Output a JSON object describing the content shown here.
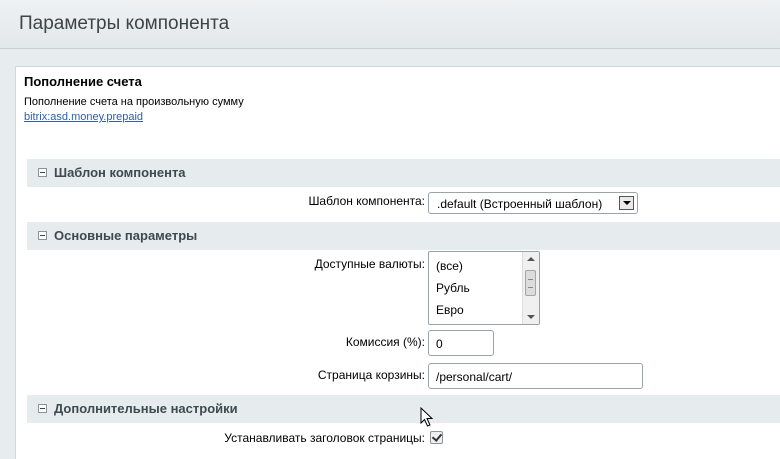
{
  "window": {
    "title": "Параметры компонента"
  },
  "component": {
    "name": "Пополнение счета",
    "description": "Пополнение счета на произвольную сумму",
    "id": "bitrix:asd.money.prepaid"
  },
  "sections": [
    {
      "title": "Шаблон компонента",
      "fields": [
        {
          "label": "Шаблон компонента:",
          "value": ".default (Встроенный шаблон)"
        }
      ]
    },
    {
      "title": "Основные параметры",
      "fields": [
        {
          "label": "Доступные валюты:",
          "options": [
            "(все)",
            "Рубль",
            "Евро"
          ]
        },
        {
          "label": "Комиссия (%):",
          "value": "0"
        },
        {
          "label": "Страница корзины:",
          "value": "/personal/cart/"
        }
      ]
    },
    {
      "title": "Дополнительные настройки",
      "fields": [
        {
          "label": "Устанавливать заголовок страницы:",
          "checked": true
        }
      ]
    }
  ]
}
